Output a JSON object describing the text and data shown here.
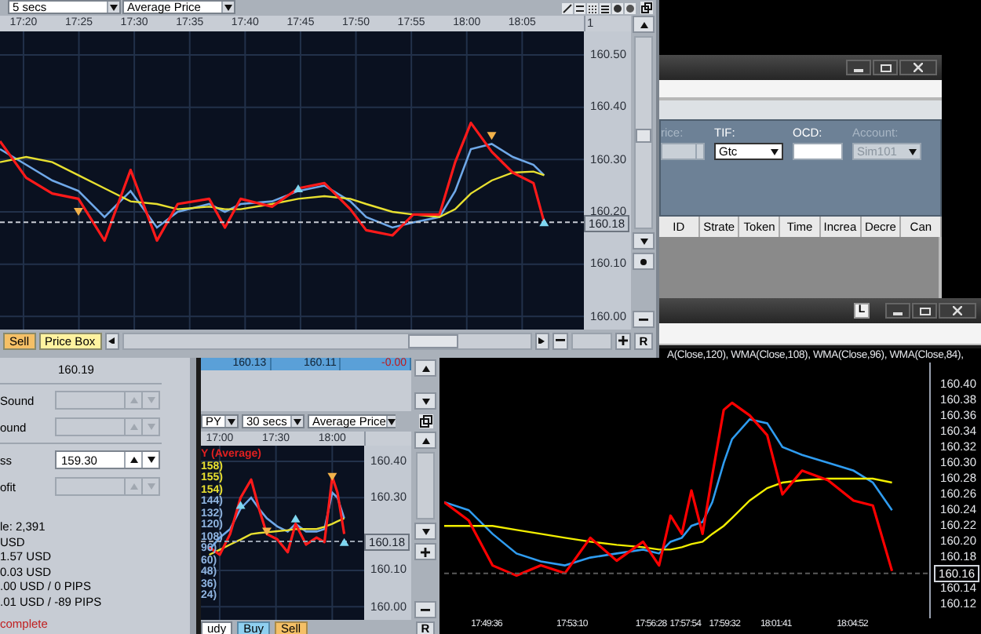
{
  "top_chart": {
    "interval": "5 secs",
    "price_type": "Average Price",
    "axis_fragment": "1",
    "chart_data": {
      "type": "line",
      "x": [
        1037.88,
        1040.24,
        1042.59,
        1044.96,
        1047.32,
        1049.67,
        1052.04,
        1053.92,
        1056.76,
        1058.17,
        1059.59,
        1062.42,
        1064.79,
        1067.15,
        1069.5,
        1070.92,
        1073.29,
        1075.17,
        1077.54,
        1078.95,
        1080.37,
        1082.25,
        1084.15,
        1086.03,
        1086.98
      ],
      "series": [
        {
          "color": "#ff1a1a",
          "values": [
            160.335,
            160.265,
            160.235,
            160.225,
            160.145,
            160.28,
            160.145,
            160.215,
            160.225,
            160.17,
            160.225,
            160.21,
            160.245,
            160.255,
            160.205,
            160.165,
            160.155,
            160.195,
            160.195,
            160.295,
            160.37,
            160.315,
            160.275,
            160.255,
            160.18
          ]
        },
        {
          "color": "#6fa8e8",
          "values": [
            160.32,
            160.29,
            160.26,
            160.24,
            160.19,
            160.24,
            160.17,
            160.2,
            160.215,
            160.2,
            160.215,
            160.22,
            160.24,
            160.25,
            160.22,
            160.19,
            160.17,
            160.18,
            160.19,
            160.24,
            160.32,
            160.33,
            160.305,
            160.29,
            160.27
          ]
        },
        {
          "color": "#e8e030",
          "values": [
            160.295,
            160.305,
            160.295,
            160.27,
            160.245,
            160.22,
            160.215,
            160.205,
            160.21,
            160.205,
            160.205,
            160.215,
            160.225,
            160.23,
            160.225,
            160.215,
            160.2,
            160.195,
            160.19,
            160.205,
            160.235,
            160.26,
            160.275,
            160.277,
            160.27
          ]
        },
        {
          "type": "scatter",
          "color": "#7fd6f0",
          "values": [
            null,
            null,
            null,
            null,
            null,
            null,
            null,
            null,
            null,
            null,
            null,
            null,
            160.245,
            null,
            null,
            null,
            null,
            null,
            null,
            null,
            null,
            null,
            null,
            null,
            160.18
          ]
        },
        {
          "type": "scatter",
          "color": "#f2b24a",
          "values": [
            null,
            null,
            null,
            160.2,
            null,
            null,
            null,
            null,
            null,
            null,
            null,
            null,
            null,
            null,
            null,
            null,
            null,
            null,
            null,
            null,
            null,
            160.345,
            null,
            null,
            null
          ]
        }
      ],
      "xlim": [
        1037.88,
        1090.57
      ],
      "ylim": [
        159.975,
        160.545
      ],
      "grid": true,
      "xticks": [
        {
          "value": 1040,
          "label": "17:20"
        },
        {
          "value": 1045,
          "label": "17:25"
        },
        {
          "value": 1050,
          "label": "17:30"
        },
        {
          "value": 1055,
          "label": "17:35"
        },
        {
          "value": 1060,
          "label": "17:40"
        },
        {
          "value": 1065,
          "label": "17:45"
        },
        {
          "value": 1070,
          "label": "17:50"
        },
        {
          "value": 1075,
          "label": "17:55"
        },
        {
          "value": 1080,
          "label": "18:00"
        },
        {
          "value": 1085,
          "label": "18:05"
        }
      ],
      "yticks": [
        {
          "value": 160.5,
          "label": "160.50"
        },
        {
          "value": 160.4,
          "label": "160.40"
        },
        {
          "value": 160.3,
          "label": "160.30"
        },
        {
          "value": 160.2,
          "label": "160.20"
        },
        {
          "value": 160.1,
          "label": "160.10"
        },
        {
          "value": 160.0,
          "label": "160.00"
        }
      ],
      "ref_lines": [
        {
          "axis": "y",
          "value": 160.18,
          "label": "160.18"
        }
      ]
    },
    "buttons": [
      {
        "label": "Sell",
        "kind": "sell"
      },
      {
        "label": "Price Box",
        "kind": "box"
      }
    ],
    "reset_label": "R"
  },
  "order_window": {
    "fields": [
      {
        "label": "rice:",
        "kind": "spinner",
        "disabled": true
      },
      {
        "label": "TIF:",
        "kind": "dropdown",
        "value": "Gtc",
        "disabled": false
      },
      {
        "label": "OCD:",
        "kind": "text",
        "disabled": false
      },
      {
        "label": "Account:",
        "kind": "dropdown",
        "value": "Sim101",
        "disabled": true
      }
    ],
    "columns": [
      "ID",
      "Strate",
      "Token",
      "Time",
      "Increa",
      "Decre",
      "Can"
    ]
  },
  "main_chart": {
    "title_button": "L",
    "legend": "A(Close,120), WMA(Close,108), WMA(Close,96), WMA(Close,84),",
    "chart_data": {
      "type": "line",
      "x": [
        1067.83,
        1068.85,
        1069.85,
        1070.85,
        1071.87,
        1072.87,
        1073.93,
        1075.03,
        1076.13,
        1076.8,
        1077.28,
        1077.75,
        1078.15,
        1078.62,
        1079.02,
        1079.5,
        1079.85,
        1080.58,
        1081.32,
        1081.95,
        1082.77,
        1083.85,
        1084.92,
        1085.73,
        1086.53
      ],
      "series": [
        {
          "color": "#ff0000",
          "values": [
            160.25,
            160.227,
            160.17,
            160.157,
            160.17,
            160.16,
            160.205,
            160.176,
            160.2,
            160.17,
            160.233,
            160.21,
            160.265,
            160.21,
            160.284,
            160.367,
            160.376,
            160.36,
            160.335,
            160.26,
            160.29,
            160.278,
            160.252,
            160.246,
            160.163
          ]
        },
        {
          "color": "#2f9cf0",
          "values": [
            160.25,
            160.24,
            160.21,
            160.185,
            160.175,
            160.17,
            160.18,
            160.185,
            160.19,
            160.185,
            160.2,
            160.205,
            160.22,
            160.225,
            160.25,
            160.3,
            160.33,
            160.355,
            160.35,
            160.32,
            160.31,
            160.3,
            160.29,
            160.275,
            160.24
          ]
        },
        {
          "color": "#f2ee00",
          "values": [
            160.22,
            160.22,
            160.22,
            160.215,
            160.21,
            160.205,
            160.2,
            160.196,
            160.193,
            160.19,
            160.19,
            160.193,
            160.197,
            160.2,
            160.21,
            160.22,
            160.23,
            160.252,
            160.268,
            160.275,
            160.278,
            160.28,
            160.28,
            160.28,
            160.275
          ]
        }
      ],
      "xlim": [
        1067.83,
        1088.08
      ],
      "ylim": [
        160.103,
        160.427
      ],
      "xticks": [
        {
          "value": 1069.6,
          "label": "17:49:36"
        },
        {
          "value": 1073.167,
          "label": "17:53:10"
        },
        {
          "value": 1076.467,
          "label": "17:56:28"
        },
        {
          "value": 1077.9,
          "label": "17:57:54"
        },
        {
          "value": 1079.533,
          "label": "17:59:32"
        },
        {
          "value": 1081.683,
          "label": "18:01:41"
        },
        {
          "value": 1084.867,
          "label": "18:04:52"
        }
      ],
      "yticks": [
        {
          "value": 160.4,
          "label": "160.40"
        },
        {
          "value": 160.38,
          "label": "160.38"
        },
        {
          "value": 160.36,
          "label": "160.36"
        },
        {
          "value": 160.34,
          "label": "160.34"
        },
        {
          "value": 160.32,
          "label": "160.32"
        },
        {
          "value": 160.3,
          "label": "160.30"
        },
        {
          "value": 160.28,
          "label": "160.28"
        },
        {
          "value": 160.26,
          "label": "160.26"
        },
        {
          "value": 160.24,
          "label": "160.24"
        },
        {
          "value": 160.22,
          "label": "160.22"
        },
        {
          "value": 160.2,
          "label": "160.20"
        },
        {
          "value": 160.18,
          "label": "160.18"
        },
        {
          "value": 160.14,
          "label": "160.14"
        },
        {
          "value": 160.12,
          "label": "160.12"
        }
      ],
      "ref_lines": [
        {
          "axis": "y",
          "value": 160.16,
          "label": "160.16"
        }
      ]
    }
  },
  "order_panel": {
    "last_price": "160.19",
    "field_groups": [
      [
        {
          "label": "Sound",
          "disabled": true
        },
        {
          "label": "ound",
          "disabled": true
        }
      ],
      [
        {
          "label": "ss",
          "value": "159.30",
          "disabled": false
        },
        {
          "label": "ofit",
          "disabled": true
        }
      ]
    ],
    "stats": [
      "le: 2,391",
      "USD",
      "1.57 USD",
      "0.03 USD",
      ".00 USD / 0 PIPS",
      ".01 USD / -89 PIPS"
    ],
    "status": "complete"
  },
  "small_chart": {
    "quotes": [
      {
        "text": "160.13",
        "kind": "price"
      },
      {
        "text": "160.11",
        "kind": "price"
      },
      {
        "text": "-0.00",
        "kind": "change"
      }
    ],
    "instrument": "PY",
    "interval": "30 secs",
    "price_type": "Average Price",
    "legend": [
      {
        "text": "Y (Average)",
        "color": "#e02020"
      },
      {
        "text": "158)",
        "color": "#e8e030"
      },
      {
        "text": "155)",
        "color": "#e8e030"
      },
      {
        "text": "154)",
        "color": "#e8e030"
      },
      {
        "text": "144)",
        "color": "#8fb4e0"
      },
      {
        "text": "132)",
        "color": "#8fb4e0"
      },
      {
        "text": "120)",
        "color": "#8fb4e0"
      },
      {
        "text": "108)",
        "color": "#8fb4e0"
      },
      {
        "text": "96)",
        "color": "#8fb4e0"
      },
      {
        "text": "60)",
        "color": "#8fb4e0"
      },
      {
        "text": "48)",
        "color": "#8fb4e0"
      },
      {
        "text": "36)",
        "color": "#8fb4e0"
      },
      {
        "text": "24)",
        "color": "#8fb4e0"
      }
    ],
    "chart_data": {
      "type": "line",
      "x": [
        1014.42,
        1020,
        1025.58,
        1031.17,
        1036.73,
        1040.93,
        1045.12,
        1050.68,
        1056.27,
        1060.45,
        1066.03,
        1071.62,
        1075.8,
        1080,
        1082.78,
        1086.4
      ],
      "series": [
        {
          "color": "#ff1a1a",
          "values": [
            160.164,
            160.143,
            160.2,
            160.3,
            160.35,
            160.27,
            160.2,
            160.186,
            160.15,
            160.228,
            160.171,
            160.19,
            160.178,
            160.357,
            160.314,
            160.2
          ]
        },
        {
          "color": "#6fa8e8",
          "values": [
            160.157,
            160.19,
            160.214,
            160.27,
            160.3,
            160.27,
            160.243,
            160.221,
            160.207,
            160.228,
            160.207,
            160.207,
            160.214,
            160.314,
            160.3,
            160.243
          ]
        },
        {
          "color": "#e8e030",
          "values": [
            160.143,
            160.157,
            160.171,
            160.185,
            160.2,
            160.203,
            160.205,
            160.208,
            160.211,
            160.214,
            160.214,
            160.214,
            160.22,
            160.228,
            160.235,
            160.243
          ]
        },
        {
          "type": "scatter",
          "color": "#7fd6f0",
          "values": [
            null,
            null,
            null,
            160.28,
            null,
            null,
            null,
            null,
            null,
            160.243,
            null,
            null,
            null,
            null,
            null,
            160.178
          ]
        },
        {
          "type": "scatter",
          "color": "#f2b24a",
          "values": [
            null,
            null,
            null,
            null,
            null,
            null,
            160.207,
            null,
            null,
            null,
            null,
            null,
            null,
            160.357,
            null,
            null
          ]
        }
      ],
      "xlim": [
        1010,
        1097
      ],
      "ylim": [
        159.964,
        160.443
      ],
      "grid": true,
      "xticks": [
        {
          "value": 1020,
          "label": "17:00"
        },
        {
          "value": 1050,
          "label": "17:30"
        },
        {
          "value": 1080,
          "label": "18:00"
        }
      ],
      "yticks": [
        {
          "value": 160.4,
          "label": "160.40"
        },
        {
          "value": 160.3,
          "label": "160.30"
        },
        {
          "value": 160.1,
          "label": "160.10"
        },
        {
          "value": 160.0,
          "label": "160.00"
        }
      ],
      "ref_lines": [
        {
          "axis": "y",
          "value": 160.18,
          "label": "160.18"
        }
      ]
    },
    "bottom_labels": [
      {
        "text": "udy",
        "kind": "dropdown"
      },
      {
        "text": "Buy",
        "kind": "buy"
      },
      {
        "text": "Sell",
        "kind": "sell"
      }
    ],
    "reset_label": "R"
  }
}
